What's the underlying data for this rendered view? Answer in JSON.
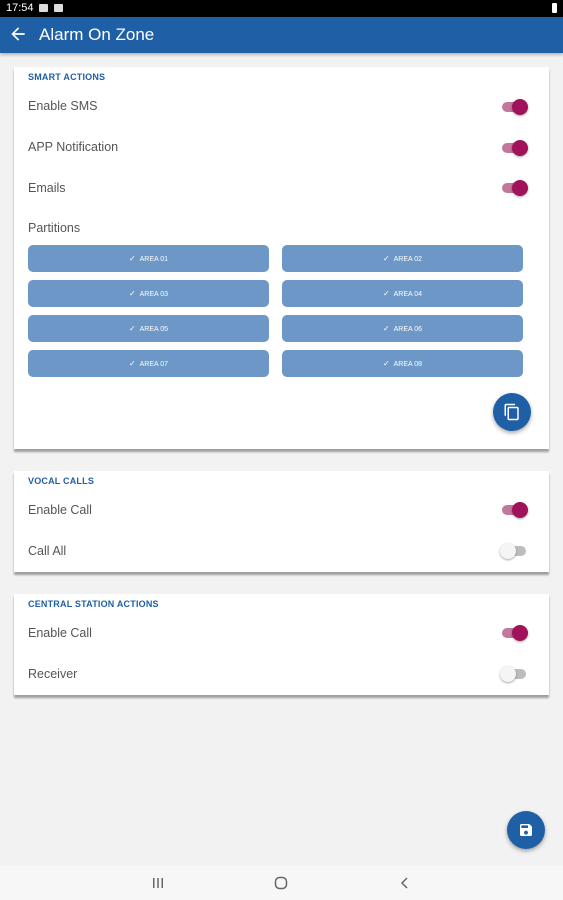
{
  "status_bar": {
    "time": "17:54"
  },
  "app_bar": {
    "title": "Alarm On Zone",
    "back_icon": "arrow-left-icon"
  },
  "smart_actions": {
    "title": "SMART ACTIONS",
    "enable_sms": {
      "label": "Enable SMS",
      "on": true
    },
    "app_notification": {
      "label": "APP Notification",
      "on": true
    },
    "emails": {
      "label": "Emails",
      "on": true
    },
    "partitions_label": "Partitions",
    "partitions": [
      "AREA 01",
      "AREA 02",
      "AREA 03",
      "AREA 04",
      "AREA 05",
      "AREA 06",
      "AREA 07",
      "AREA 08"
    ],
    "copy_icon": "copy-icon"
  },
  "vocal_calls": {
    "title": "VOCAL CALLS",
    "enable_call": {
      "label": "Enable Call",
      "on": true
    },
    "call_all": {
      "label": "Call All",
      "on": false
    }
  },
  "central_station": {
    "title": "CENTRAL STATION ACTIONS",
    "enable_call": {
      "label": "Enable Call",
      "on": true
    },
    "receiver": {
      "label": "Receiver",
      "on": false
    }
  },
  "save_icon": "save-icon",
  "colors": {
    "primary": "#1f5fa5",
    "switch_on": "#a0125a",
    "chip": "#6c97c6"
  }
}
